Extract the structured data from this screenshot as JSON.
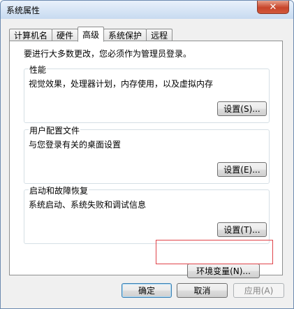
{
  "window": {
    "title": "系统属性",
    "close_glyph": "✕"
  },
  "tabs": [
    {
      "label": "计算机名",
      "active": false
    },
    {
      "label": "硬件",
      "active": false
    },
    {
      "label": "高级",
      "active": true
    },
    {
      "label": "系统保护",
      "active": false
    },
    {
      "label": "远程",
      "active": false
    }
  ],
  "panel": {
    "admin_note": "要进行大多数更改，您必须作为管理员登录。",
    "performance": {
      "title": "性能",
      "description": "视觉效果，处理器计划，内存使用，以及虚拟内存",
      "button_label": "设置(S)..."
    },
    "user_profiles": {
      "title": "用户配置文件",
      "description": "与您登录有关的桌面设置",
      "button_label": "设置(E)..."
    },
    "startup_recovery": {
      "title": "启动和故障恢复",
      "description": "系统启动、系统失败和调试信息",
      "button_label": "设置(T)..."
    },
    "env_vars_label": "环境变量(N)..."
  },
  "footer": {
    "ok_label": "确定",
    "cancel_label": "取消",
    "apply_label": "应用(A)"
  },
  "colors": {
    "highlight_border": "#e0444a",
    "close_button": "#c7452b"
  }
}
